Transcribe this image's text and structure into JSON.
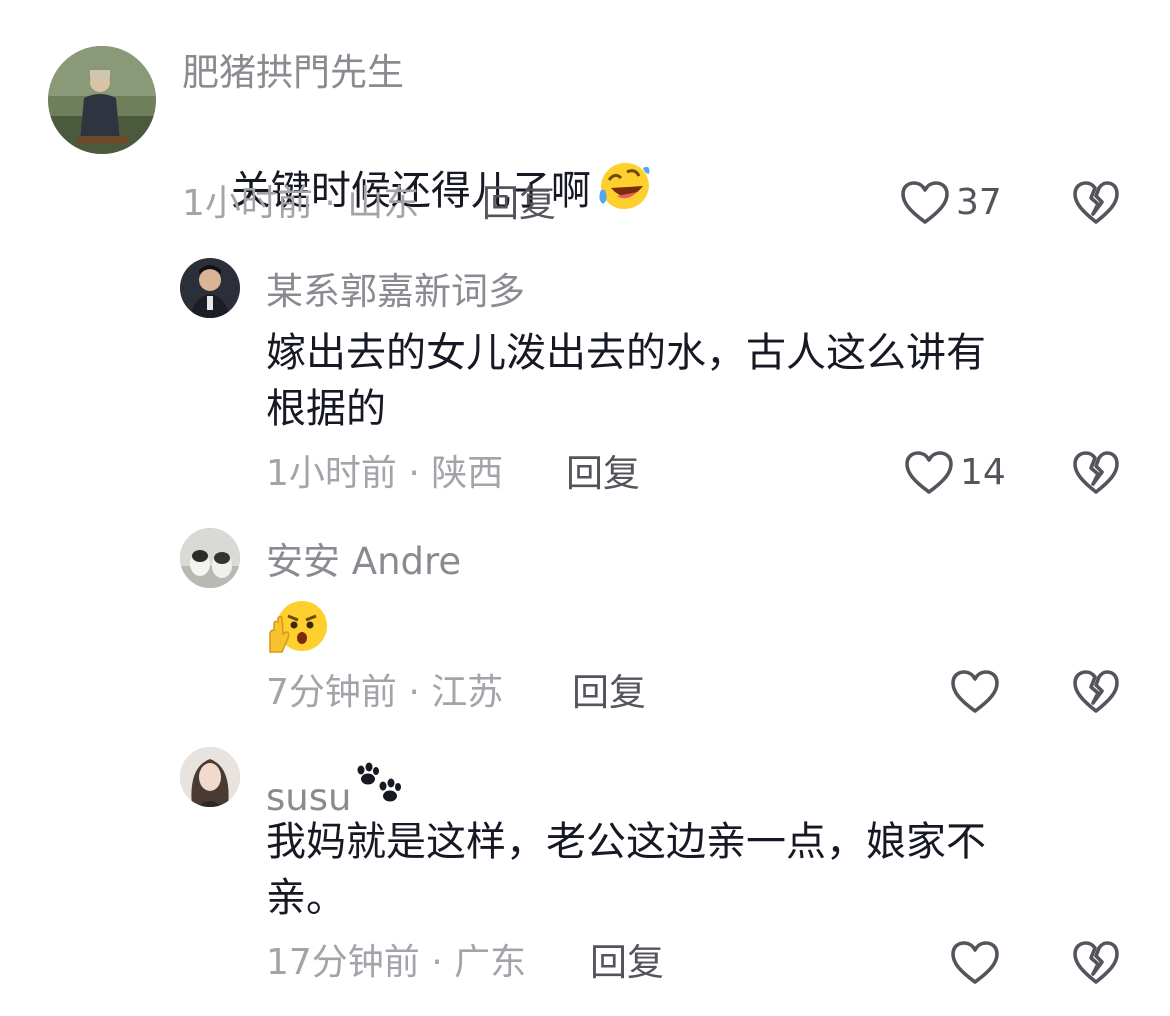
{
  "comments": [
    {
      "username": "肥猪拱門先生",
      "text": "关键时候还得儿子啊",
      "emoji": "laughing-crying-emoji",
      "time": "1小时前",
      "location": "山东",
      "meta": "1小时前 · 山东",
      "reply_label": "回复",
      "likes": "37"
    },
    {
      "username": "某系郭嘉新词多",
      "text": "嫁出去的女儿泼出去的水，古人这么讲有\n根据的",
      "time": "1小时前",
      "location": "陕西",
      "meta": "1小时前 · 陕西",
      "reply_label": "回复",
      "likes": "14"
    },
    {
      "username": "安安 Andre",
      "text": "",
      "emoji": "shocked-hand-emoji",
      "time": "7分钟前",
      "location": "江苏",
      "meta": "7分钟前 · 江苏",
      "reply_label": "回复",
      "likes": ""
    },
    {
      "username": "susu",
      "username_icon": "paw-prints-icon",
      "text": "我妈就是这样，老公这边亲一点，娘家不\n亲。",
      "time": "17分钟前",
      "location": "广东",
      "meta": "17分钟前 · 广东",
      "reply_label": "回复",
      "likes": ""
    }
  ],
  "icons": {
    "like": "heart-outline-icon",
    "dislike": "broken-heart-icon"
  },
  "colors": {
    "username": "#8a8b91",
    "text": "#161823",
    "meta": "#a3a4a9",
    "reply": "#54555c",
    "icon": "#54555c"
  }
}
